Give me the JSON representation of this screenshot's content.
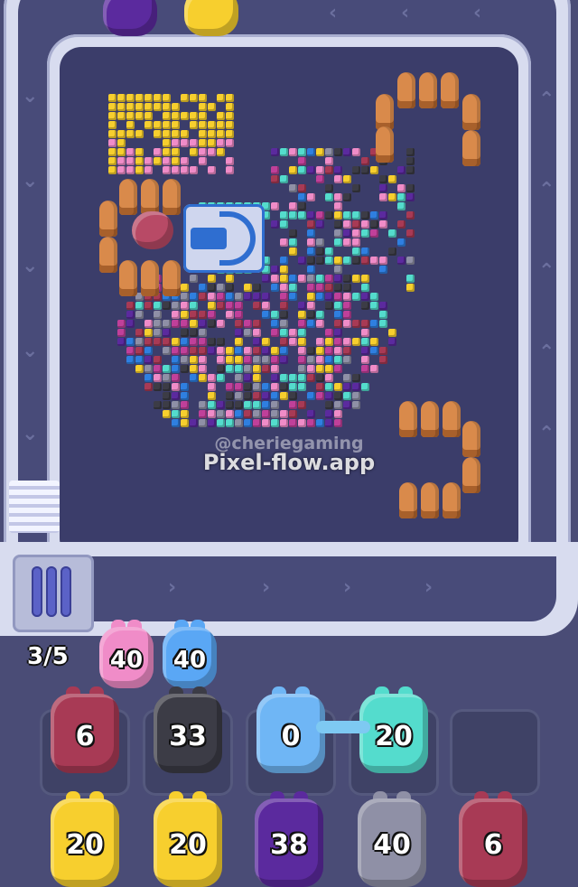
{
  "game": {
    "launcher_counter": "3/5",
    "watermark_handle": "@cheriegaming",
    "watermark_site": "Pixel-flow.app"
  },
  "colors": {
    "pink": "#f08cc8",
    "blue": "#5aa7f5",
    "maroon": "#a83a55",
    "black": "#3c3c46",
    "light-blue": "#6fb6f5",
    "cyan": "#54dccd",
    "yellow": "#f7cf2e",
    "purple": "#5b2a9e",
    "gray": "#8f90a6",
    "orange-stump": "#d98a4b"
  },
  "top_pigs": [
    {
      "color": "purple",
      "icon": "pig-icon"
    },
    {
      "color": "yellow",
      "icon": "pig-icon"
    }
  ],
  "queue_pigs": [
    {
      "color": "pink",
      "count": "40"
    },
    {
      "color": "blue",
      "count": "40"
    }
  ],
  "slots": [
    {
      "color": "maroon",
      "count": "6"
    },
    {
      "color": "black",
      "count": "33"
    },
    {
      "color": "light-blue",
      "count": "0"
    },
    {
      "color": "cyan",
      "count": "20"
    },
    {
      "color": "",
      "count": ""
    }
  ],
  "bottom_pigs": [
    {
      "color": "yellow",
      "count": "20"
    },
    {
      "color": "yellow",
      "count": "20"
    },
    {
      "color": "purple",
      "count": "38"
    },
    {
      "color": "gray",
      "count": "40"
    },
    {
      "color": "maroon",
      "count": "6"
    }
  ]
}
